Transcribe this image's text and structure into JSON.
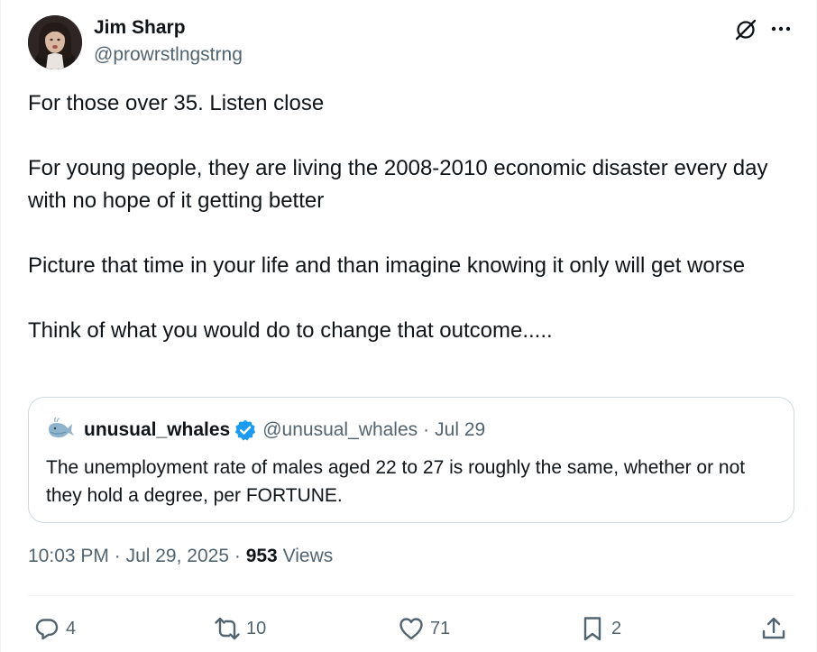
{
  "author": {
    "name": "Jim Sharp",
    "handle": "@prowrstlngstrng"
  },
  "icons": {
    "grok": "grok-icon",
    "more": "more-icon"
  },
  "tweet": {
    "paragraphs": [
      "For those over 35. Listen close",
      "For young people, they are living the 2008-2010 economic disaster every day with no hope of it getting better",
      "Picture that time in your life and than imagine knowing it only will get worse",
      "Think of what you would do to change that outcome....."
    ]
  },
  "quote": {
    "name": "unusual_whales",
    "handle": "@unusual_whales",
    "separator": "·",
    "date": "Jul 29",
    "text": "The unemployment rate of males aged 22 to 27 is roughly the same, whether or not they hold a degree, per FORTUNE.",
    "verified_color": "#1d9bf0"
  },
  "meta": {
    "time": "10:03 PM",
    "separator": "·",
    "date": "Jul 29, 2025",
    "views_count": "953",
    "views_label": "Views"
  },
  "actions": {
    "replies": "4",
    "reposts": "10",
    "likes": "71",
    "bookmarks": "2"
  },
  "colors": {
    "text": "#0f1419",
    "secondary": "#536471",
    "border": "#cfd9de",
    "accent": "#1d9bf0"
  }
}
